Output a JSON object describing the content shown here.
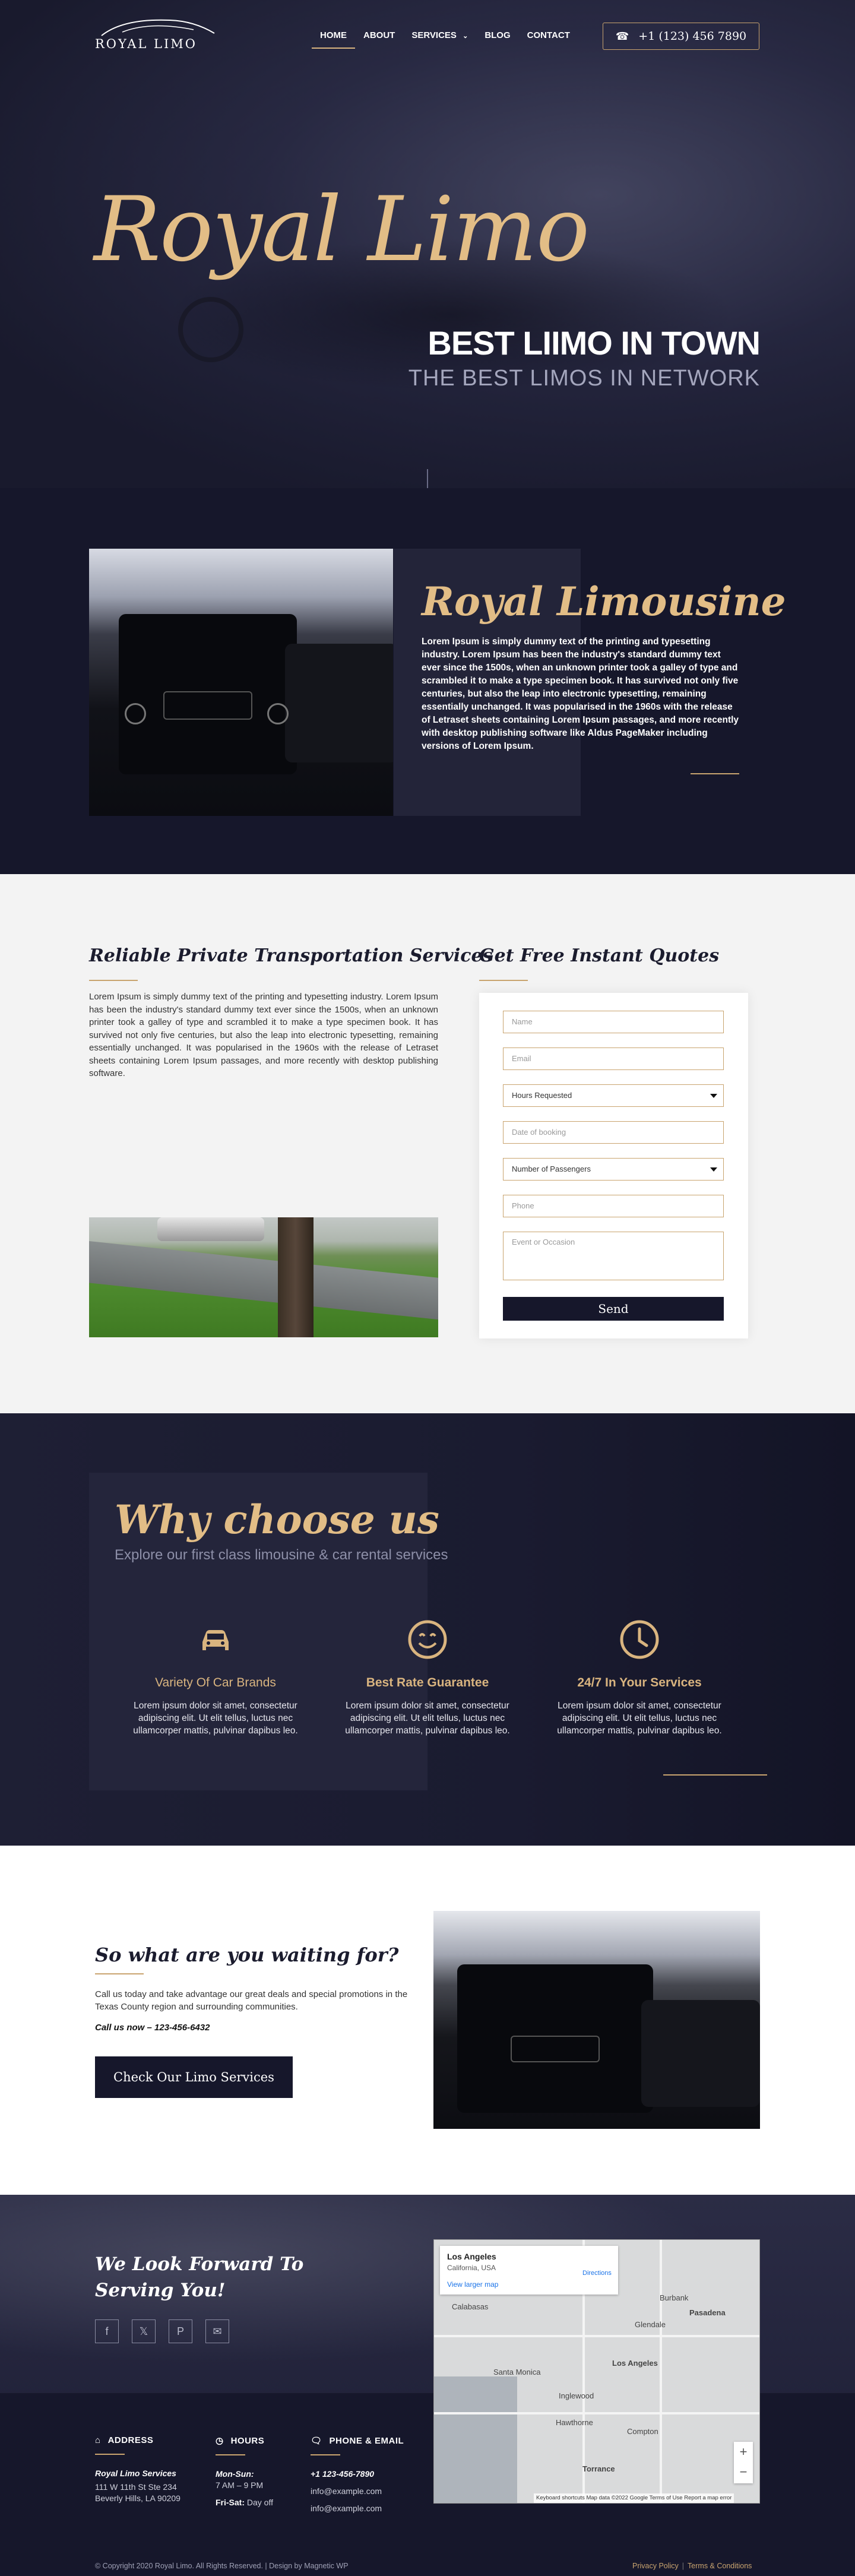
{
  "brand": {
    "logo_text": "ROYAL LIMO"
  },
  "nav": {
    "items": [
      {
        "label": "HOME",
        "active": true
      },
      {
        "label": "ABOUT"
      },
      {
        "label": "SERVICES"
      },
      {
        "label": "BLOG"
      },
      {
        "label": "CONTACT"
      }
    ],
    "phone": "+1 (123) 456 7890"
  },
  "hero": {
    "script_title": "Royal Limo",
    "headline": "BEST LIIMO IN TOWN",
    "subheadline": "THE BEST LIMOS IN NETWORK"
  },
  "about": {
    "title": "Royal Limousine",
    "text": "Lorem Ipsum is simply dummy text of the printing and typesetting industry. Lorem Ipsum has been the industry's standard dummy text ever since the 1500s, when an unknown printer took a galley of type and scrambled it to make a type specimen book. It has survived not only five centuries, but also the leap into electronic typesetting, remaining essentially unchanged. It was popularised in the 1960s with the release of Letraset sheets containing Lorem Ipsum passages, and more recently with desktop publishing software like Aldus PageMaker including versions of Lorem Ipsum."
  },
  "services": {
    "title": "Reliable Private Transportation Services",
    "text": "Lorem Ipsum is simply dummy text of the printing and typesetting industry. Lorem Ipsum has been the industry's standard dummy text ever since the 1500s, when an unknown printer took a galley of type and scrambled it to make a type specimen book. It has survived not only five centuries, but also the leap into electronic typesetting, remaining essentially unchanged. It was popularised in the 1960s with the release of Letraset sheets containing Lorem Ipsum passages, and more recently with desktop publishing software."
  },
  "quote_form": {
    "title": "Get Free Instant Quotes",
    "name_placeholder": "Name",
    "email_placeholder": "Email",
    "hours_select": "Hours Requested",
    "date_placeholder": "Date of booking",
    "passengers_select": "Number of Passengers",
    "phone_placeholder": "Phone",
    "event_placeholder": "Event or Occasion",
    "submit_label": "Send"
  },
  "why": {
    "title": "Why choose us",
    "subtitle": "Explore our first class limousine & car rental services",
    "features": [
      {
        "icon": "car-icon",
        "name": "Variety Of Car Brands",
        "text": "Lorem ipsum dolor sit amet, consectetur adipiscing elit. Ut elit tellus, luctus nec ullamcorper mattis, pulvinar dapibus leo."
      },
      {
        "icon": "smile-icon",
        "name": "Best Rate Guarantee",
        "text": "Lorem ipsum dolor sit amet, consectetur adipiscing elit. Ut elit tellus, luctus nec ullamcorper mattis, pulvinar dapibus leo."
      },
      {
        "icon": "clock-icon",
        "name": "24/7 In Your Services",
        "text": "Lorem ipsum dolor sit amet, consectetur adipiscing elit. Ut elit tellus, luctus nec ullamcorper mattis, pulvinar dapibus leo."
      }
    ]
  },
  "cta": {
    "title": "So what are you waiting for?",
    "text": "Call us today and take advantage our great deals and special promotions in the Texas County region and surrounding communities.",
    "call": "Call us now – 123-456-6432",
    "button": "Check Our Limo Services"
  },
  "footer": {
    "title": "We Look Forward To Serving You!",
    "socials": [
      "facebook-icon",
      "twitter-icon",
      "pinterest-icon",
      "email-icon"
    ],
    "map": {
      "place": "Los Angeles",
      "region": "California, USA",
      "link": "View larger map",
      "directions": "Directions",
      "labels": [
        "Pasadena",
        "Los Angeles",
        "Torrance",
        "Glendale",
        "Santa Monica",
        "Inglewood",
        "Compton",
        "Hawthorne",
        "Burbank",
        "Calabasas"
      ],
      "attribution": "Keyboard shortcuts   Map data ©2022 Google   Terms of Use   Report a map error"
    },
    "address": {
      "heading": "ADDRESS",
      "name": "Royal Limo Services",
      "line1": "111 W 11th St Ste 234",
      "line2": "Beverly Hills, LA 90209"
    },
    "hours": {
      "heading": "HOURS",
      "days1": "Mon-Sun:",
      "time1": "7 AM – 9 PM",
      "days2": "Fri-Sat:",
      "time2": "Day off"
    },
    "contact": {
      "heading": "PHONE & EMAIL",
      "phone": "+1 123-456-7890",
      "email1": "info@example.com",
      "email2": "info@example.com"
    },
    "copyright": "© Copyright 2020 Royal Limo. All Rights Reserved. | Design by Magnetic WP",
    "privacy": "Privacy Policy",
    "terms": "Terms & Conditions"
  },
  "colors": {
    "navy": "#16172b",
    "gold": "#d9b47f",
    "light": "#f3f3f3"
  }
}
